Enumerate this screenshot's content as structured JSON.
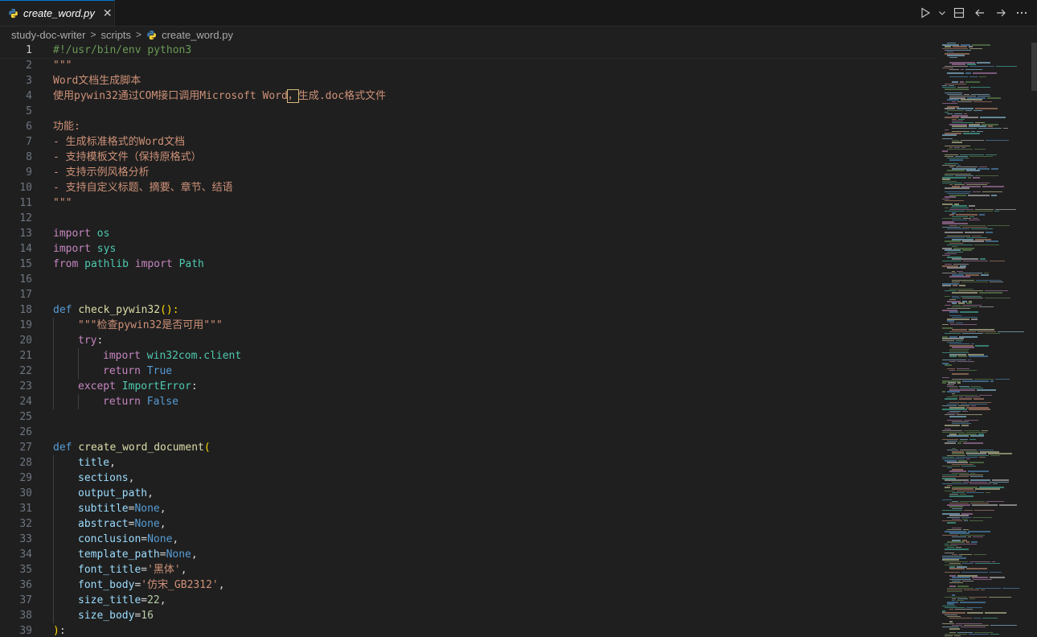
{
  "tab": {
    "label": "create_word.py",
    "close": "✕"
  },
  "breadcrumb": {
    "items": [
      "study-doc-writer",
      "scripts",
      "create_word.py"
    ],
    "separator": ">"
  },
  "editor": {
    "current_line": 1,
    "lines": [
      {
        "n": "1",
        "indent": 0,
        "tokens": [
          [
            "c-comment",
            "#!/usr/bin/env python3"
          ]
        ]
      },
      {
        "n": "2",
        "indent": 0,
        "tokens": [
          [
            "c-string",
            "\"\"\""
          ]
        ]
      },
      {
        "n": "3",
        "indent": 0,
        "tokens": [
          [
            "c-string",
            "Word文档生成脚本"
          ]
        ]
      },
      {
        "n": "4",
        "indent": 0,
        "tokens": [
          [
            "c-string",
            "使用pywin32通过COM接口调用Microsoft Word"
          ],
          [
            "c-string hl-char",
            "，"
          ],
          [
            "c-string",
            "生成.doc格式文件"
          ]
        ]
      },
      {
        "n": "5",
        "indent": 0,
        "tokens": []
      },
      {
        "n": "6",
        "indent": 0,
        "tokens": [
          [
            "c-string",
            "功能:"
          ]
        ]
      },
      {
        "n": "7",
        "indent": 0,
        "tokens": [
          [
            "c-string",
            "- 生成标准格式的Word文档"
          ]
        ]
      },
      {
        "n": "8",
        "indent": 0,
        "tokens": [
          [
            "c-string",
            "- 支持模板文件（保持原格式）"
          ]
        ]
      },
      {
        "n": "9",
        "indent": 0,
        "tokens": [
          [
            "c-string",
            "- 支持示例风格分析"
          ]
        ]
      },
      {
        "n": "10",
        "indent": 0,
        "tokens": [
          [
            "c-string",
            "- 支持自定义标题、摘要、章节、结语"
          ]
        ]
      },
      {
        "n": "11",
        "indent": 0,
        "tokens": [
          [
            "c-string",
            "\"\"\""
          ]
        ]
      },
      {
        "n": "12",
        "indent": 0,
        "tokens": []
      },
      {
        "n": "13",
        "indent": 0,
        "tokens": [
          [
            "c-kw",
            "import"
          ],
          [
            "c-plain",
            " "
          ],
          [
            "c-class",
            "os"
          ]
        ]
      },
      {
        "n": "14",
        "indent": 0,
        "tokens": [
          [
            "c-kw",
            "import"
          ],
          [
            "c-plain",
            " "
          ],
          [
            "c-class",
            "sys"
          ]
        ]
      },
      {
        "n": "15",
        "indent": 0,
        "tokens": [
          [
            "c-kw",
            "from"
          ],
          [
            "c-plain",
            " "
          ],
          [
            "c-class",
            "pathlib"
          ],
          [
            "c-plain",
            " "
          ],
          [
            "c-kw",
            "import"
          ],
          [
            "c-plain",
            " "
          ],
          [
            "c-class",
            "Path"
          ]
        ]
      },
      {
        "n": "16",
        "indent": 0,
        "tokens": []
      },
      {
        "n": "17",
        "indent": 0,
        "tokens": []
      },
      {
        "n": "18",
        "indent": 0,
        "tokens": [
          [
            "c-def",
            "def"
          ],
          [
            "c-plain",
            " "
          ],
          [
            "c-fn",
            "check_pywin32"
          ],
          [
            "c-brk",
            "():"
          ]
        ]
      },
      {
        "n": "19",
        "indent": 1,
        "tokens": [
          [
            "c-string",
            "\"\"\"检查pywin32是否可用\"\"\""
          ]
        ]
      },
      {
        "n": "20",
        "indent": 1,
        "tokens": [
          [
            "c-kw",
            "try"
          ],
          [
            "c-plain",
            ":"
          ]
        ]
      },
      {
        "n": "21",
        "indent": 2,
        "tokens": [
          [
            "c-kw",
            "import"
          ],
          [
            "c-plain",
            " "
          ],
          [
            "c-class",
            "win32com.client"
          ]
        ]
      },
      {
        "n": "22",
        "indent": 2,
        "tokens": [
          [
            "c-kw",
            "return"
          ],
          [
            "c-plain",
            " "
          ],
          [
            "c-bool",
            "True"
          ]
        ]
      },
      {
        "n": "23",
        "indent": 1,
        "tokens": [
          [
            "c-kw",
            "except"
          ],
          [
            "c-plain",
            " "
          ],
          [
            "c-class",
            "ImportError"
          ],
          [
            "c-plain",
            ":"
          ]
        ]
      },
      {
        "n": "24",
        "indent": 2,
        "tokens": [
          [
            "c-kw",
            "return"
          ],
          [
            "c-plain",
            " "
          ],
          [
            "c-bool",
            "False"
          ]
        ]
      },
      {
        "n": "25",
        "indent": 0,
        "tokens": []
      },
      {
        "n": "26",
        "indent": 0,
        "tokens": []
      },
      {
        "n": "27",
        "indent": 0,
        "tokens": [
          [
            "c-def",
            "def"
          ],
          [
            "c-plain",
            " "
          ],
          [
            "c-fn",
            "create_word_document"
          ],
          [
            "c-brk",
            "("
          ]
        ]
      },
      {
        "n": "28",
        "indent": 1,
        "tokens": [
          [
            "c-var",
            "title"
          ],
          [
            "c-plain",
            ","
          ]
        ]
      },
      {
        "n": "29",
        "indent": 1,
        "tokens": [
          [
            "c-var",
            "sections"
          ],
          [
            "c-plain",
            ","
          ]
        ]
      },
      {
        "n": "30",
        "indent": 1,
        "tokens": [
          [
            "c-var",
            "output_path"
          ],
          [
            "c-plain",
            ","
          ]
        ]
      },
      {
        "n": "31",
        "indent": 1,
        "tokens": [
          [
            "c-var",
            "subtitle"
          ],
          [
            "c-op",
            "="
          ],
          [
            "c-bool",
            "None"
          ],
          [
            "c-plain",
            ","
          ]
        ]
      },
      {
        "n": "32",
        "indent": 1,
        "tokens": [
          [
            "c-var",
            "abstract"
          ],
          [
            "c-op",
            "="
          ],
          [
            "c-bool",
            "None"
          ],
          [
            "c-plain",
            ","
          ]
        ]
      },
      {
        "n": "33",
        "indent": 1,
        "tokens": [
          [
            "c-var",
            "conclusion"
          ],
          [
            "c-op",
            "="
          ],
          [
            "c-bool",
            "None"
          ],
          [
            "c-plain",
            ","
          ]
        ]
      },
      {
        "n": "34",
        "indent": 1,
        "tokens": [
          [
            "c-var",
            "template_path"
          ],
          [
            "c-op",
            "="
          ],
          [
            "c-bool",
            "None"
          ],
          [
            "c-plain",
            ","
          ]
        ]
      },
      {
        "n": "35",
        "indent": 1,
        "tokens": [
          [
            "c-var",
            "font_title"
          ],
          [
            "c-op",
            "="
          ],
          [
            "c-string",
            "'黑体'"
          ],
          [
            "c-plain",
            ","
          ]
        ]
      },
      {
        "n": "36",
        "indent": 1,
        "tokens": [
          [
            "c-var",
            "font_body"
          ],
          [
            "c-op",
            "="
          ],
          [
            "c-string",
            "'仿宋_GB2312'"
          ],
          [
            "c-plain",
            ","
          ]
        ]
      },
      {
        "n": "37",
        "indent": 1,
        "tokens": [
          [
            "c-var",
            "size_title"
          ],
          [
            "c-op",
            "="
          ],
          [
            "c-num",
            "22"
          ],
          [
            "c-plain",
            ","
          ]
        ]
      },
      {
        "n": "38",
        "indent": 1,
        "tokens": [
          [
            "c-var",
            "size_body"
          ],
          [
            "c-op",
            "="
          ],
          [
            "c-num",
            "16"
          ]
        ]
      },
      {
        "n": "39",
        "indent": 0,
        "tokens": [
          [
            "c-brk",
            ")"
          ],
          [
            "c-plain",
            ":"
          ]
        ]
      }
    ]
  },
  "colors": {
    "accent": "#0078d4",
    "python_blue": "#3c78aa",
    "python_yellow": "#ffd43b"
  },
  "icons": {
    "file": "python-icon",
    "run": "play-icon",
    "split": "split-editor-icon",
    "back": "arrow-left-icon",
    "forward": "arrow-right-icon",
    "more": "ellipsis-icon"
  }
}
